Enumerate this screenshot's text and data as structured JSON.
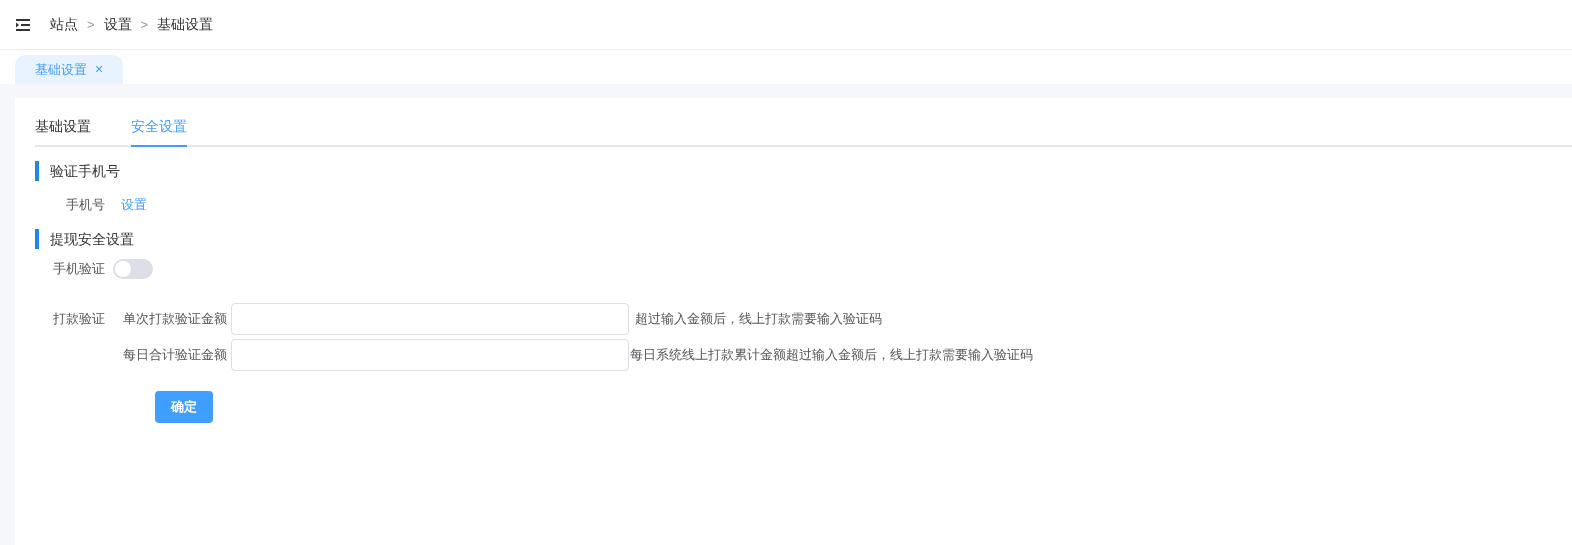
{
  "breadcrumb": [
    "站点",
    "设置",
    "基础设置"
  ],
  "breadcrumb_separator": ">",
  "page_tabs": [
    {
      "label": "基础设置",
      "selected": true,
      "close": "×"
    }
  ],
  "tabs": [
    {
      "label": "基础设置",
      "selected": false
    },
    {
      "label": "安全设置",
      "selected": true
    }
  ],
  "sections": [
    {
      "title": "验证手机号",
      "rows": [
        {
          "kind": "link",
          "label": "手机号",
          "link": "设置"
        }
      ]
    },
    {
      "title": "提现安全设置",
      "rows": [
        {
          "kind": "switch",
          "label": "手机验证",
          "on": false
        },
        {
          "kind": "fields",
          "label": "打款验证",
          "fields": [
            {
              "label": "单次打款验证金额",
              "hint": "超过输入金额后，线上打款需要输入验证码"
            },
            {
              "label": "每日合计验证金额",
              "hint": "每日系统线上打款累计金额超过输入金额后，线上打款需要输入验证码"
            }
          ]
        }
      ]
    }
  ],
  "submit": "确定"
}
